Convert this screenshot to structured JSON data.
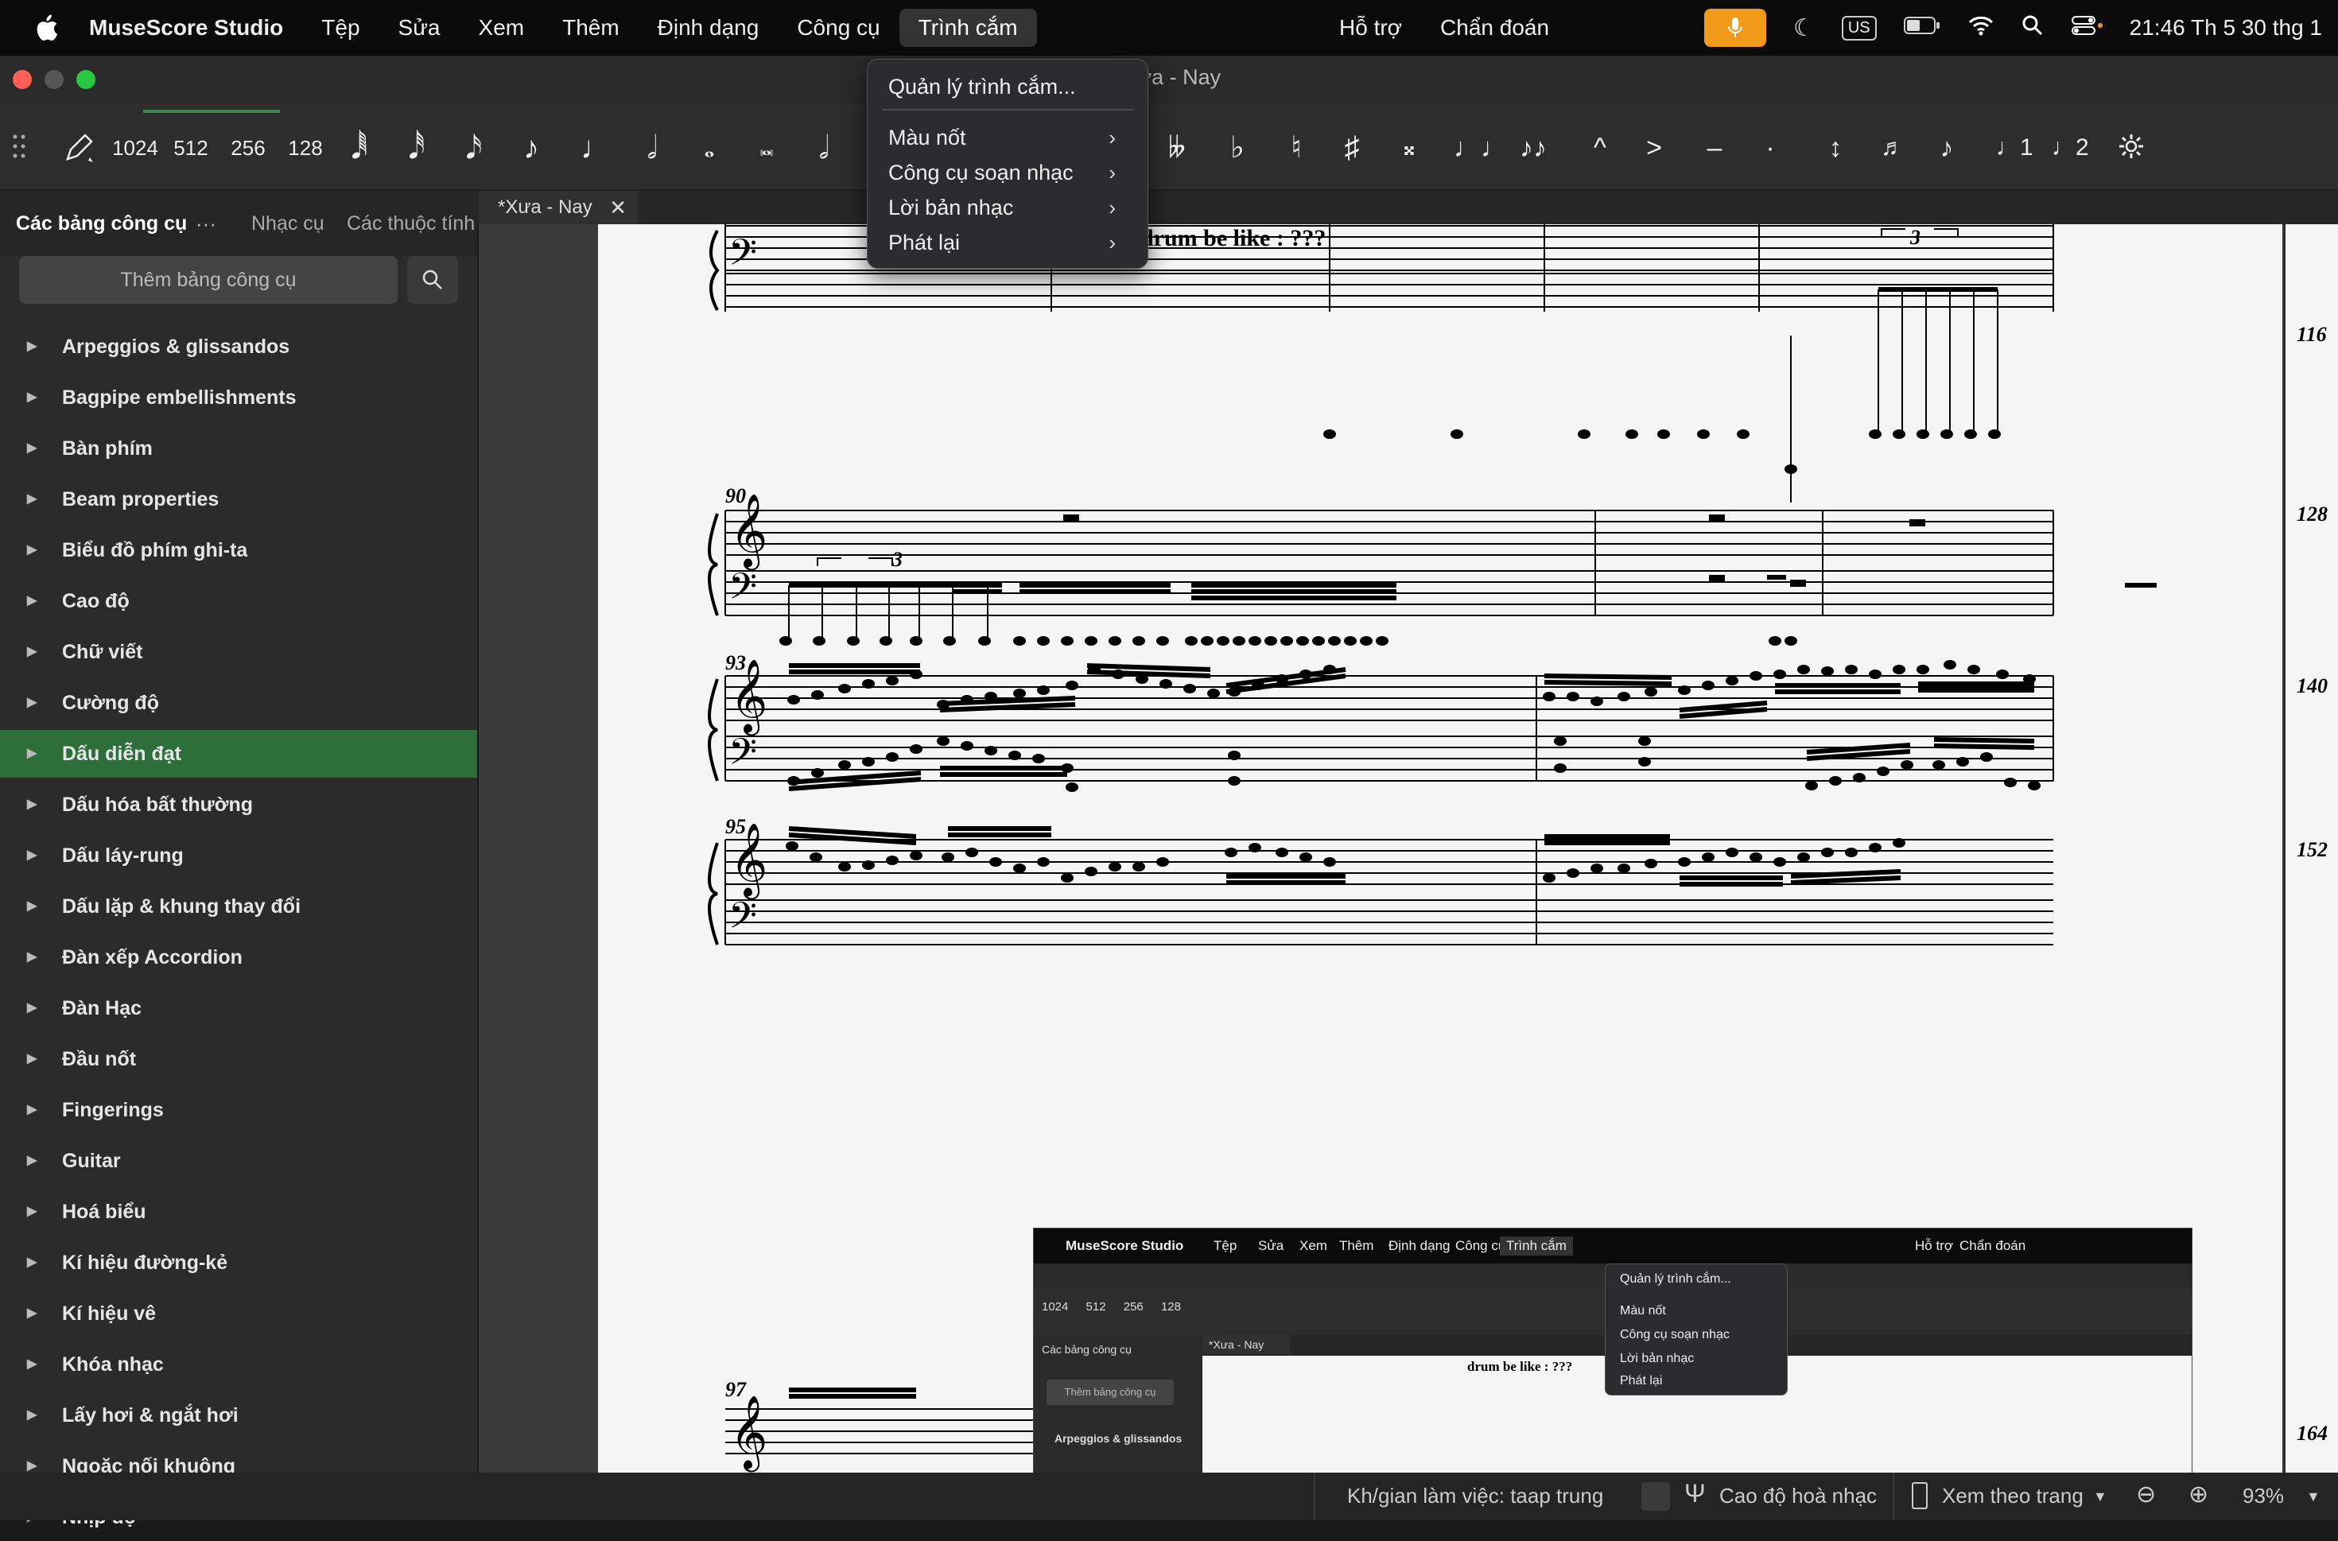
{
  "menubar": {
    "app_name": "MuseScore Studio",
    "items": [
      "Tệp",
      "Sửa",
      "Xem",
      "Thêm",
      "Định dạng",
      "Công cụ",
      "Trình cắm"
    ],
    "center_items": [
      "Hỗ trợ",
      "Chẩn đoán"
    ],
    "input_source": "US",
    "clock": "21:46 Th 5 30 thg 1"
  },
  "window": {
    "title": "*Xưa - Nay",
    "visible_title_fragment": "ưa - Nay"
  },
  "toolbar": {
    "durations": [
      "1024",
      "512",
      "256",
      "128"
    ]
  },
  "panel_tabs": [
    "Các bảng công cụ",
    "Nhạc cụ",
    "Các thuộc tính"
  ],
  "document_tab": "*Xưa - Nay",
  "palettes": {
    "add_button": "Thêm bảng công cụ",
    "items": [
      "Arpeggios & glissandos",
      "Bagpipe embellishments",
      "Bàn phím",
      "Beam properties",
      "Biểu đồ phím ghi-ta",
      "Cao độ",
      "Chữ viết",
      "Cường độ",
      "Dấu diễn đạt",
      "Dấu hóa bất thường",
      "Dấu láy-rung",
      "Dấu lặp & khung thay đổi",
      "Đàn xếp Accordion",
      "Đàn Hạc",
      "Đầu nốt",
      "Fingerings",
      "Guitar",
      "Hoá biểu",
      "Kí hiệu đường-kẻ",
      "Kí hiệu vê",
      "Khóa nhạc",
      "Lấy hơi & ngắt hơi",
      "Ngoặc nối khuông",
      "Nhịp độ"
    ],
    "selected": "Dấu diễn đạt"
  },
  "plugins_menu": {
    "items": [
      "Quản lý trình cắm...",
      "Màu nốt",
      "Công cụ soạn nhạc",
      "Lời bản nhạc",
      "Phát lại"
    ]
  },
  "score": {
    "annotation": "drum be like : ???",
    "tuplet": "3",
    "measure_numbers": [
      "90",
      "93",
      "95",
      "97"
    ],
    "right_page_measures": [
      "116",
      "128",
      "140",
      "152",
      "164"
    ]
  },
  "statusbar": {
    "workspace": "Kh/gian làm việc: taap trung",
    "concert_pitch": "Cao độ hoà nhạc",
    "view_mode": "Xem theo trang",
    "zoom": "93%"
  }
}
